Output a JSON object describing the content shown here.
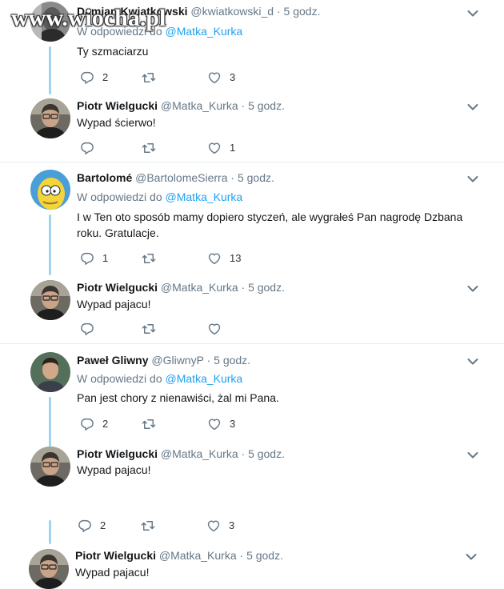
{
  "watermark": "www.wiocha.pl",
  "labels": {
    "reply_prefix": "W odpowiedzi do",
    "separator": "·"
  },
  "colors": {
    "link": "#1da1f2",
    "muted": "#657786",
    "thread_line": "#9fd3ee",
    "border": "#e6ecf0"
  },
  "icons": {
    "reply": "reply-icon",
    "retweet": "retweet-icon",
    "like": "heart-icon",
    "more": "chevron-down-icon"
  },
  "tweets": [
    {
      "name": "Damian Kwiatkowski",
      "handle": "@kwiatkowski_d",
      "time": "5 godz.",
      "reply_to": "@Matka_Kurka",
      "text": "Ty szmaciarzu",
      "replies": "2",
      "retweets": "",
      "likes": "3"
    },
    {
      "name": "Piotr Wielgucki",
      "handle": "@Matka_Kurka",
      "time": "5 godz.",
      "reply_to": "",
      "text": "Wypad ścierwo!",
      "replies": "",
      "retweets": "",
      "likes": "1"
    },
    {
      "name": "Bartolomé",
      "handle": "@BartolomeSierra",
      "time": "5 godz.",
      "reply_to": "@Matka_Kurka",
      "text": "I w Ten oto sposób mamy dopiero styczeń,  ale wygrałeś Pan nagrodę Dzbana roku. Gratulacje.",
      "replies": "1",
      "retweets": "",
      "likes": "13"
    },
    {
      "name": "Piotr Wielgucki",
      "handle": "@Matka_Kurka",
      "time": "5 godz.",
      "reply_to": "",
      "text": "Wypad pajacu!",
      "replies": "",
      "retweets": "",
      "likes": ""
    },
    {
      "name": "Paweł Gliwny",
      "handle": "@GliwnyP",
      "time": "5 godz.",
      "reply_to": "@Matka_Kurka",
      "text": "Pan jest chory z nienawiści, żal mi Pana.",
      "replies": "2",
      "retweets": "",
      "likes": "3"
    },
    {
      "name": "Piotr Wielgucki",
      "handle": "@Matka_Kurka",
      "time": "5 godz.",
      "reply_to": "",
      "text": "Wypad pajacu!",
      "replies": "",
      "retweets": "",
      "likes": ""
    },
    {
      "name": "",
      "handle": "",
      "time": "",
      "reply_to": "",
      "text": "",
      "replies": "2",
      "retweets": "",
      "likes": "3"
    },
    {
      "name": "Piotr Wielgucki",
      "handle": "@Matka_Kurka",
      "time": "5 godz.",
      "reply_to": "",
      "text": "Wypad pajacu!",
      "replies": "",
      "retweets": "",
      "likes": ""
    }
  ]
}
